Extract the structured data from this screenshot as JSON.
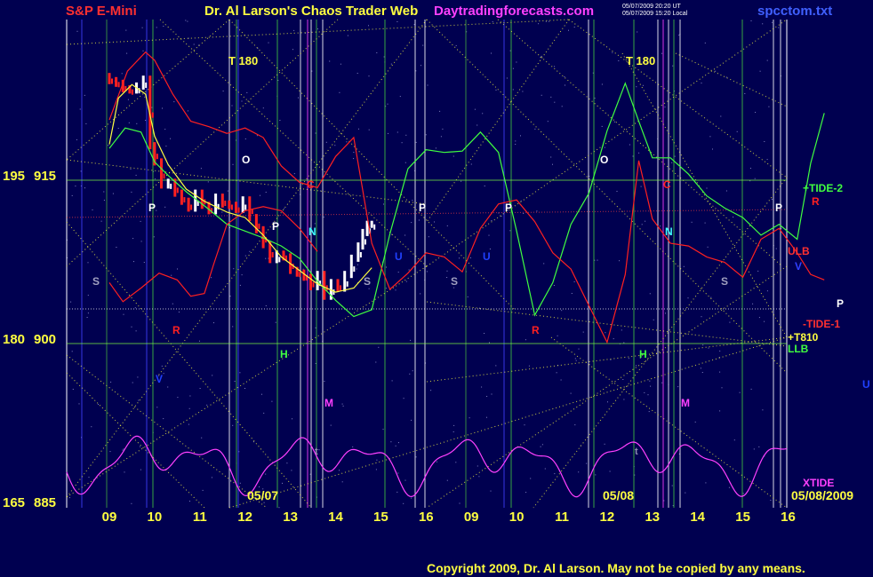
{
  "header": {
    "symbol": "S&P E-Mini",
    "title": "Dr. Al Larson's Chaos Trader Web",
    "site": "Daytradingforecasts.com",
    "stamp_line1": "05/07/2009 20:20 UT",
    "stamp_line2": "05/07/2009 15:20 Local",
    "file": "spcctom.txt"
  },
  "footer": {
    "copyright": "Copyright 2009, Dr. Al Larson. May not be copied by any means."
  },
  "colors": {
    "background": "#000050",
    "price_up": "#ffffff",
    "price_down": "#ff2020",
    "green_line": "#40ff40",
    "red_line": "#ff3030",
    "yellow_line": "#ffff40",
    "magenta_line": "#ff40ff",
    "white_grid": "#ffffff",
    "blue_grid": "#4040ff"
  },
  "chart_data": {
    "type": "line",
    "y_labels": [
      {
        "left": "195",
        "right": "915"
      },
      {
        "left": "180",
        "right": "900"
      },
      {
        "left": "165",
        "right": "885"
      }
    ],
    "ylim": [
      885,
      921
    ],
    "x_ticks": [
      "09",
      "10",
      "11",
      "12",
      "13",
      "14",
      "15",
      "16",
      "09",
      "10",
      "11",
      "12",
      "13",
      "14",
      "15",
      "16"
    ],
    "date_labels": [
      "05/07",
      "05/08",
      "05/08/2009"
    ],
    "top_labels": [
      "T 180",
      "T 180"
    ],
    "right_labels": [
      "+TIDE-2",
      "R",
      "ULB",
      "V",
      "P",
      "-TIDE-1",
      "+T810",
      "LLB",
      "U",
      "XTIDE"
    ],
    "in_chart_labels": {
      "O": "O",
      "P": "P",
      "C": "C",
      "N": "N",
      "S": "S",
      "R": "R",
      "H": "H",
      "M": "M",
      "V": "V",
      "U": "U",
      "t": "t"
    },
    "series": [
      {
        "kind": "price",
        "points": [
          [
            0.0,
            916.8
          ],
          [
            0.15,
            916.5
          ],
          [
            0.3,
            916.3
          ],
          [
            0.45,
            915.9
          ],
          [
            0.6,
            915.8
          ],
          [
            0.75,
            916.1
          ],
          [
            0.9,
            916.6
          ],
          [
            1.0,
            911.7
          ],
          [
            1.15,
            910.5
          ],
          [
            1.3,
            908.8
          ],
          [
            1.45,
            909.0
          ],
          [
            1.6,
            908.2
          ],
          [
            1.75,
            907.6
          ],
          [
            1.9,
            907.1
          ],
          [
            2.05,
            908.2
          ],
          [
            2.2,
            907.3
          ],
          [
            2.35,
            906.9
          ],
          [
            2.5,
            907.9
          ],
          [
            2.65,
            907.4
          ],
          [
            2.8,
            907.3
          ],
          [
            2.95,
            907.0
          ],
          [
            3.1,
            907.7
          ],
          [
            3.25,
            906.4
          ],
          [
            3.4,
            905.5
          ],
          [
            3.55,
            904.4
          ],
          [
            3.7,
            903.3
          ],
          [
            3.85,
            903.7
          ],
          [
            4.0,
            903.5
          ],
          [
            4.15,
            902.5
          ],
          [
            4.3,
            902.3
          ],
          [
            4.45,
            902.0
          ],
          [
            4.6,
            901.3
          ],
          [
            4.75,
            902.2
          ],
          [
            4.9,
            900.6
          ],
          [
            5.05,
            901.6
          ],
          [
            5.2,
            901.2
          ],
          [
            5.35,
            902.2
          ],
          [
            5.5,
            903.4
          ],
          [
            5.6,
            904.3
          ],
          [
            5.7,
            905.3
          ],
          [
            5.8,
            905.9
          ]
        ]
      },
      {
        "kind": "green",
        "points": [
          [
            0,
            911.5
          ],
          [
            0.35,
            913.0
          ],
          [
            0.7,
            912.7
          ],
          [
            1.0,
            910.5
          ],
          [
            1.3,
            909.5
          ],
          [
            1.7,
            908.3
          ],
          [
            2.2,
            907.0
          ],
          [
            2.6,
            905.9
          ],
          [
            3.0,
            905.4
          ],
          [
            3.4,
            904.9
          ],
          [
            3.8,
            904.3
          ],
          [
            4.2,
            903.4
          ],
          [
            4.6,
            901.7
          ],
          [
            5.0,
            900.3
          ],
          [
            5.4,
            899.1
          ],
          [
            5.8,
            899.6
          ],
          [
            6.2,
            905.2
          ],
          [
            6.6,
            910.0
          ],
          [
            7.0,
            911.4
          ],
          [
            7.4,
            911.2
          ],
          [
            7.8,
            911.3
          ],
          [
            8.2,
            912.7
          ],
          [
            8.6,
            911.2
          ],
          [
            9.0,
            905.4
          ],
          [
            9.4,
            899.2
          ],
          [
            9.8,
            901.6
          ],
          [
            10.2,
            905.9
          ],
          [
            10.6,
            908.2
          ],
          [
            11.0,
            912.8
          ],
          [
            11.4,
            916.3
          ],
          [
            11.7,
            913.5
          ],
          [
            12.0,
            910.8
          ],
          [
            12.4,
            910.8
          ],
          [
            12.8,
            909.6
          ],
          [
            13.2,
            908.0
          ],
          [
            13.6,
            907.1
          ],
          [
            14.0,
            906.4
          ],
          [
            14.4,
            905.1
          ],
          [
            14.8,
            905.9
          ],
          [
            15.2,
            904.8
          ],
          [
            15.5,
            910.4
          ],
          [
            15.8,
            914.1
          ]
        ]
      },
      {
        "kind": "red_upper",
        "points": [
          [
            0,
            913.6
          ],
          [
            0.4,
            917.2
          ],
          [
            0.8,
            918.6
          ],
          [
            1.0,
            918.0
          ],
          [
            1.4,
            915.5
          ],
          [
            1.8,
            913.5
          ],
          [
            2.2,
            913.1
          ],
          [
            2.6,
            912.6
          ],
          [
            3.0,
            913.0
          ],
          [
            3.4,
            912.3
          ],
          [
            3.8,
            910.2
          ],
          [
            4.2,
            909.0
          ],
          [
            4.6,
            908.6
          ],
          [
            5.0,
            910.9
          ],
          [
            5.4,
            912.3
          ],
          [
            5.8,
            904.5
          ],
          [
            6.2,
            901.1
          ],
          [
            6.6,
            902.3
          ],
          [
            7.0,
            903.8
          ],
          [
            7.4,
            903.5
          ],
          [
            7.8,
            902.4
          ],
          [
            8.2,
            905.6
          ],
          [
            8.6,
            907.4
          ],
          [
            9.0,
            907.7
          ],
          [
            9.4,
            906.1
          ],
          [
            9.8,
            903.8
          ],
          [
            10.2,
            902.6
          ],
          [
            10.6,
            899.9
          ],
          [
            11.0,
            897.2
          ],
          [
            11.4,
            902.2
          ],
          [
            11.7,
            910.6
          ],
          [
            12.0,
            906.3
          ],
          [
            12.4,
            904.5
          ],
          [
            12.8,
            904.3
          ],
          [
            13.2,
            903.5
          ],
          [
            13.6,
            903.1
          ],
          [
            14.0,
            902.0
          ],
          [
            14.4,
            904.8
          ],
          [
            14.8,
            905.6
          ],
          [
            15.2,
            903.8
          ],
          [
            15.5,
            902.2
          ],
          [
            15.8,
            901.8
          ]
        ]
      },
      {
        "kind": "red_lower",
        "points": [
          [
            0,
            901.6
          ],
          [
            0.3,
            900.2
          ],
          [
            0.7,
            901.2
          ],
          [
            1.1,
            902.3
          ],
          [
            1.5,
            901.8
          ],
          [
            1.8,
            900.6
          ],
          [
            2.1,
            900.8
          ],
          [
            2.3,
            902.9
          ],
          [
            2.6,
            905.9
          ],
          [
            3.0,
            906.9
          ],
          [
            3.4,
            907.2
          ],
          [
            3.8,
            906.9
          ],
          [
            4.2,
            905.6
          ],
          [
            4.6,
            903.9
          ]
        ]
      },
      {
        "kind": "yellow_avg",
        "points": [
          [
            0,
            911.8
          ],
          [
            0.2,
            915.2
          ],
          [
            0.5,
            916.2
          ],
          [
            0.8,
            915.5
          ],
          [
            1.0,
            912.4
          ],
          [
            1.3,
            910.3
          ],
          [
            1.7,
            908.5
          ],
          [
            2.1,
            907.6
          ],
          [
            2.6,
            906.8
          ],
          [
            3.0,
            906.4
          ],
          [
            3.4,
            905.1
          ],
          [
            3.8,
            903.5
          ],
          [
            4.2,
            902.5
          ],
          [
            4.6,
            901.5
          ],
          [
            5.0,
            900.9
          ],
          [
            5.4,
            901.2
          ],
          [
            5.8,
            902.7
          ]
        ]
      },
      {
        "kind": "xtide",
        "amplitude_mode": "oscillator"
      }
    ]
  }
}
